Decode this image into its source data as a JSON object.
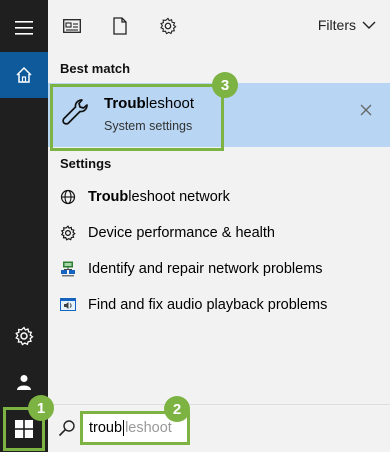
{
  "toolbar": {
    "icons": [
      "apps-icon",
      "document-icon",
      "settings-icon"
    ],
    "filters_label": "Filters"
  },
  "best_match": {
    "header": "Best match",
    "item": {
      "title_bold": "Troub",
      "title_rest": "leshoot",
      "subtitle": "System settings"
    }
  },
  "settings": {
    "header": "Settings",
    "items": [
      {
        "label_bold": "Troub",
        "label_rest": "leshoot network",
        "icon": "network-globe-icon"
      },
      {
        "label_bold": "",
        "label_rest": "Device performance & health",
        "icon": "gear-icon"
      },
      {
        "label_bold": "",
        "label_rest": "Identify and repair network problems",
        "icon": "network-repair-icon"
      },
      {
        "label_bold": "",
        "label_rest": "Find and fix audio playback problems",
        "icon": "audio-troubleshoot-icon"
      }
    ]
  },
  "search": {
    "typed": "troub",
    "suggestion": "leshoot"
  },
  "callouts": [
    "1",
    "2",
    "3"
  ],
  "colors": {
    "accent_green": "#7cb342",
    "highlight_blue": "#b8d6f3",
    "rail_dark": "#1f1f1f",
    "home_blue": "#0e5a9a"
  }
}
